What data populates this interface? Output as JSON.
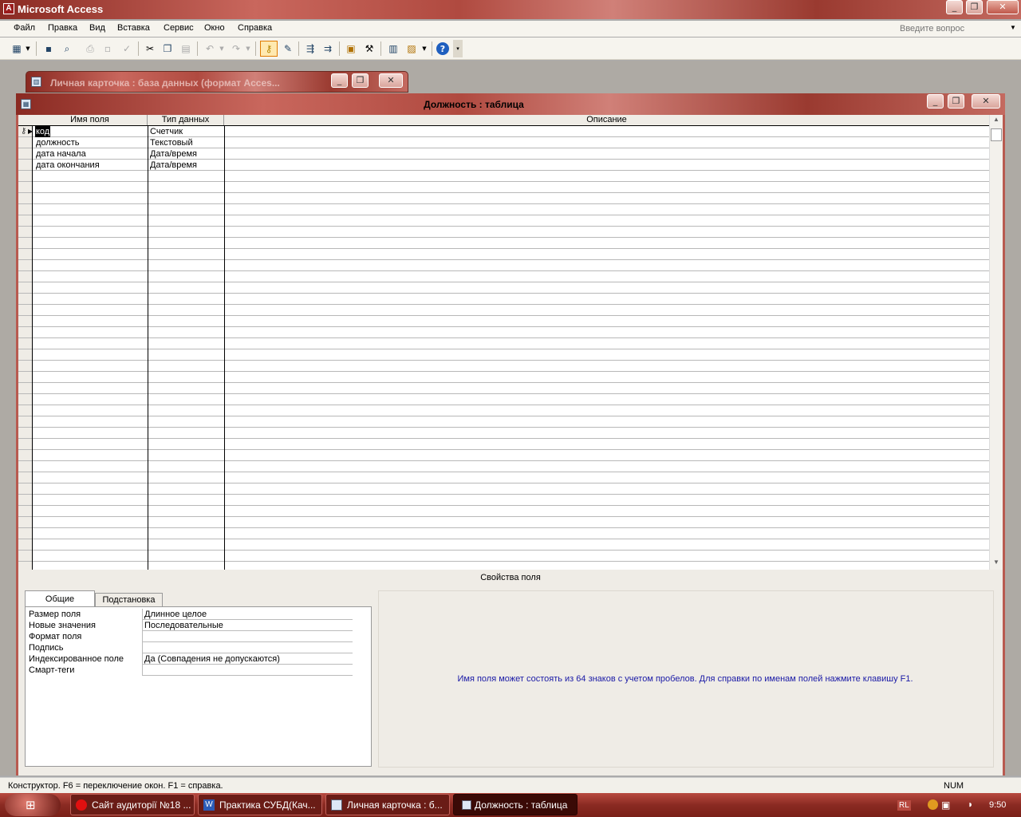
{
  "app_title": "Microsoft Access",
  "menu": [
    "Файл",
    "Правка",
    "Вид",
    "Вставка",
    "Сервис",
    "Окно",
    "Справка"
  ],
  "search_placeholder": "Введите вопрос",
  "db_window_title": "Личная карточка : база данных (формат Acces...",
  "table_window_title": "Должность : таблица",
  "grid": {
    "headers": [
      "Имя поля",
      "Тип данных",
      "Описание"
    ],
    "rows": [
      {
        "name": "код",
        "type": "Счетчик",
        "key": true
      },
      {
        "name": "должность",
        "type": "Текстовый"
      },
      {
        "name": "дата начала",
        "type": "Дата/время"
      },
      {
        "name": "дата окончания",
        "type": "Дата/время"
      }
    ]
  },
  "field_props": {
    "title": "Свойства поля",
    "tabs": [
      "Общие",
      "Подстановка"
    ],
    "rows": [
      {
        "label": "Размер поля",
        "value": "Длинное целое"
      },
      {
        "label": "Новые значения",
        "value": "Последовательные"
      },
      {
        "label": "Формат поля",
        "value": ""
      },
      {
        "label": "Подпись",
        "value": ""
      },
      {
        "label": "Индексированное поле",
        "value": "Да (Совпадения не допускаются)"
      },
      {
        "label": "Смарт-теги",
        "value": ""
      }
    ],
    "hint": "Имя поля может состоять из 64 знаков с учетом пробелов.  Для справки по именам полей нажмите клавишу F1."
  },
  "status": {
    "text": "Конструктор.  F6 = переключение окон.  F1 = справка.",
    "num": "NUM"
  },
  "taskbar": {
    "items": [
      "Сайт аудиторії №18 ...",
      "Практика СУБД(Кач...",
      "Личная карточка : б...",
      "Должность : таблица"
    ],
    "lang": "RL",
    "clock": "9:50"
  }
}
